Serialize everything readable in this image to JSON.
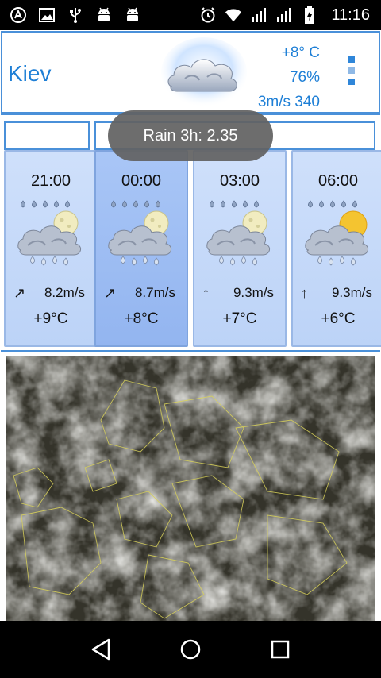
{
  "status_bar": {
    "time": "11:16",
    "icons": [
      "app-a-icon",
      "image-icon",
      "usb-icon",
      "android-icon",
      "android-icon",
      "alarm-icon",
      "wifi-icon",
      "signal-icon",
      "signal-icon",
      "battery-charging-icon"
    ]
  },
  "header": {
    "city": "Kiev",
    "temperature": "+8° C",
    "humidity": "76%",
    "wind": "3m/s 340",
    "weather_icon": "cloudy-icon",
    "menu_icon": "menu-dots-icon"
  },
  "toast": {
    "text": "Rain 3h: 2.35"
  },
  "forecast": [
    {
      "time": "21:00",
      "wind": "8.2m/s",
      "temp": "+9°C",
      "icon": "rain-night-icon",
      "selected": false
    },
    {
      "time": "00:00",
      "wind": "8.7m/s",
      "temp": "+8°C",
      "icon": "rain-night-icon",
      "selected": true
    },
    {
      "time": "03:00",
      "wind": "9.3m/s",
      "temp": "+7°C",
      "icon": "rain-night-icon",
      "selected": false
    },
    {
      "time": "06:00",
      "wind": "9.3m/s",
      "temp": "+6°C",
      "icon": "rain-day-icon",
      "selected": false
    }
  ],
  "map": {
    "description_icon": "satellite-map-icon"
  },
  "nav_bar": {
    "icons": [
      "back-icon",
      "home-icon",
      "recents-icon"
    ]
  },
  "colors": {
    "accent": "#1e7fd6",
    "border": "#4a90d9",
    "cell": "#cfe0fb",
    "cell_selected": "#a9c6f6"
  }
}
